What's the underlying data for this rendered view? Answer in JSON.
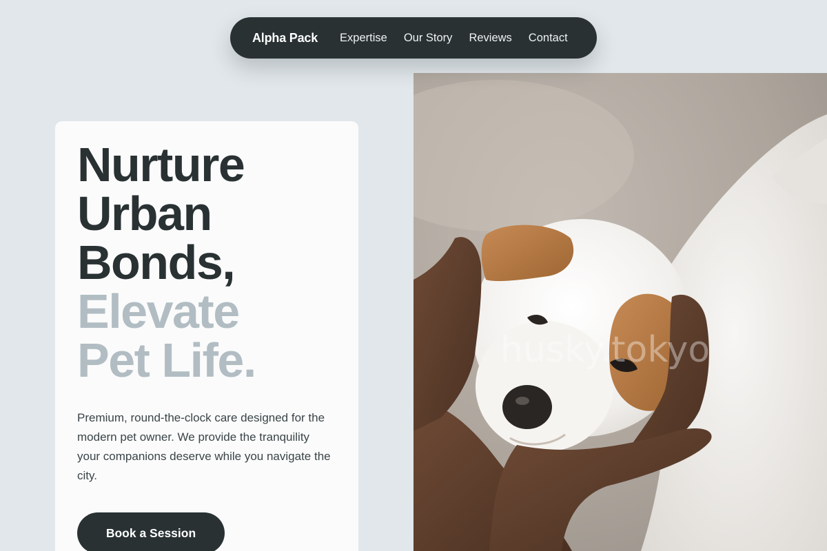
{
  "nav": {
    "brand": "Alpha Pack",
    "links": [
      "Expertise",
      "Our Story",
      "Reviews",
      "Contact"
    ]
  },
  "hero": {
    "headline_dark": [
      "Nurture",
      "Urban",
      "Bonds,"
    ],
    "headline_light": [
      "Elevate",
      "Pet Life."
    ],
    "description": "Premium, round-the-clock care designed for the modern pet owner. We provide the tranquility your companions deserve while you navigate the city.",
    "cta_label": "Book a Session"
  },
  "photo": {
    "subject": "white-and-orange puppy held in two hands",
    "watermark": "husky.tokyo"
  },
  "colors": {
    "background": "#e1e7ea",
    "nav_bg": "#293133",
    "card_bg": "#fbfbfb",
    "headline_dark": "#293133",
    "headline_light": "#b1bdc2",
    "button_bg": "#293133"
  }
}
